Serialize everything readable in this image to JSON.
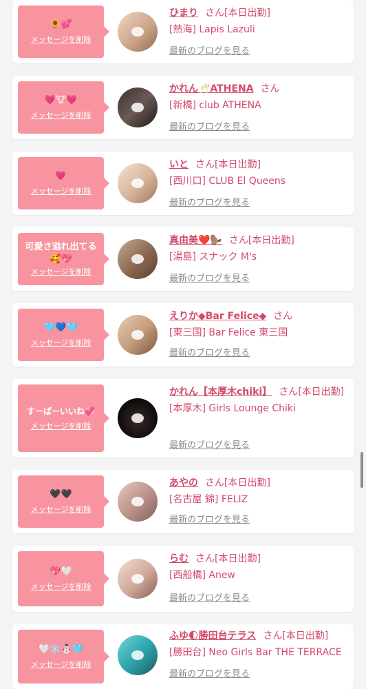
{
  "delete_label": "メッセージを削除",
  "blog_label": "最新のブログを見る",
  "san_label": "さん",
  "accent_color": "#f8949f",
  "name_color": "#d24a6a",
  "entries": [
    {
      "message": "🌻💕",
      "name": "ひまり",
      "suffix": "[本日出勤]",
      "shop": "[熱海] Lapis Lazuli"
    },
    {
      "message": "💗🐮💗",
      "name": "かれん🥂ATHENA",
      "suffix": "",
      "shop": "[新橋] club ATHENA"
    },
    {
      "message": "💗",
      "name": "いと",
      "suffix": "[本日出勤]",
      "shop": "[西川口] CLUB El Queens"
    },
    {
      "message": "可愛さ溢れ出てる🥰💖",
      "name": "真由美❤️🦫",
      "suffix": "[本日出勤]",
      "shop": "[湯島] スナック M's"
    },
    {
      "message": "🩵💙🩵",
      "name": "えりか◆Bar Felice◆",
      "suffix": "",
      "shop": "[東三国] Bar Felice 東三国"
    },
    {
      "message": "すーぱーいいね💞",
      "name": "かれん【本厚木chiki】",
      "suffix": "[本日出勤]",
      "shop": "[本厚木] Girls Lounge Chiki"
    },
    {
      "message": "🖤🖤",
      "name": "あやの",
      "suffix": "[本日出勤]",
      "shop": "[名古屋 錦] FELIZ"
    },
    {
      "message": "💖🤍",
      "name": "らむ",
      "suffix": "[本日出勤]",
      "shop": "[西船橋] Anew"
    },
    {
      "message": "🤍❄️☃️🩵",
      "name": "ふゆ🌓勝田台テラス",
      "suffix": "[本日出勤]",
      "shop": "[勝田台] Neo Girls Bar THE TERRACE"
    }
  ]
}
